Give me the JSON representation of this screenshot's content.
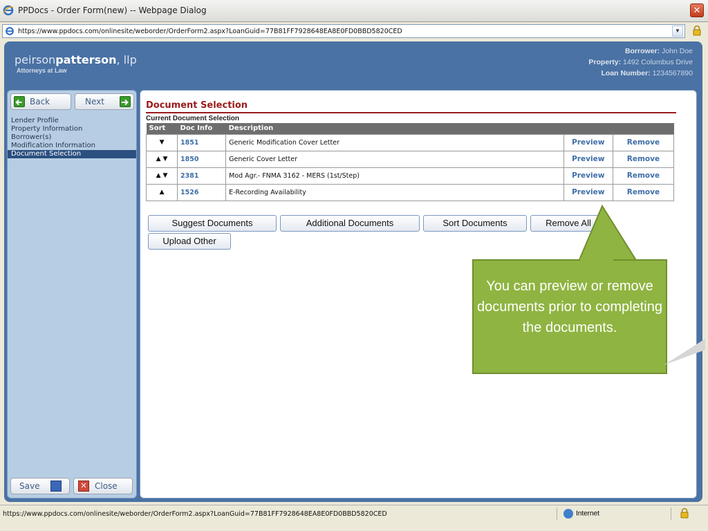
{
  "window": {
    "title": "PPDocs - Order Form(new) -- Webpage Dialog",
    "close_label": "✕"
  },
  "address": {
    "url": "https://www.ppdocs.com/onlinesite/weborder/OrderForm2.aspx?LoanGuid=77B81FF7928648EA8E0FD0BBD5820CED"
  },
  "header": {
    "firm_light": "peirson",
    "firm_bold": "patterson",
    "firm_suffix": ", llp",
    "tagline": "Attorneys at Law",
    "borrower_label": "Borrower:",
    "borrower": "John Doe",
    "property_label": "Property:",
    "property": "1492 Columbus Drive",
    "loan_label": "Loan Number:",
    "loan": "1234567890"
  },
  "sidebar": {
    "back_label": "Back",
    "next_label": "Next",
    "items": [
      {
        "label": "Lender Profile"
      },
      {
        "label": "Property Information"
      },
      {
        "label": "Borrower(s)"
      },
      {
        "label": "Modification Information"
      },
      {
        "label": "Document Selection"
      }
    ],
    "save_label": "Save",
    "close_label": "Close"
  },
  "main": {
    "title": "Document Selection",
    "subtitle": "Current Document Selection",
    "columns": [
      "Sort",
      "Doc Info",
      "Description",
      "",
      ""
    ],
    "rows": [
      {
        "sort": "▼",
        "doc": "1851",
        "desc": "Generic Modification Cover Letter",
        "preview": "Preview",
        "remove": "Remove"
      },
      {
        "sort": "▲ ▼",
        "doc": "1850",
        "desc": "Generic Cover Letter",
        "preview": "Preview",
        "remove": "Remove"
      },
      {
        "sort": "▲ ▼",
        "doc": "2381",
        "desc": "Mod Agr.- FNMA 3162 - MERS (1st/Step)",
        "preview": "Preview",
        "remove": "Remove"
      },
      {
        "sort": "▲",
        "doc": "1526",
        "desc": "E-Recording Availability",
        "preview": "Preview",
        "remove": "Remove"
      }
    ],
    "buttons": {
      "suggest": "Suggest Documents",
      "additional": "Additional Documents",
      "sort": "Sort Documents",
      "remove_all": "Remove All",
      "upload": "Upload Other"
    }
  },
  "callout": {
    "text": "You can preview or remove documents prior to completing the documents."
  },
  "statusbar": {
    "url": "https://www.ppdocs.com/onlinesite/weborder/OrderForm2.aspx?LoanGuid=77B81FF7928648EA8E0FD0BBD5820CED",
    "zone": "Internet"
  },
  "colors": {
    "header_blue": "#4a72a4",
    "sidebar_blue": "#b7cde4",
    "title_red": "#9a1b1b",
    "link_blue": "#3f6ea7",
    "callout_green": "#8fb441"
  }
}
